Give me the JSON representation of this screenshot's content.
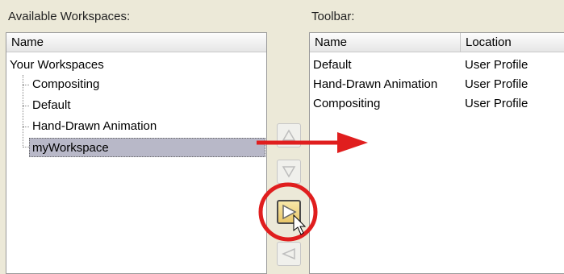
{
  "left_panel": {
    "label": "Available Workspaces:",
    "column_header": "Name",
    "tree": {
      "root": "Your Workspaces",
      "children": [
        "Compositing",
        "Default",
        "Hand-Drawn Animation",
        "myWorkspace"
      ],
      "selected": "myWorkspace"
    }
  },
  "right_panel": {
    "label": "Toolbar:",
    "columns": [
      "Name",
      "Location"
    ],
    "rows": [
      {
        "name": "Default",
        "location": "User Profile"
      },
      {
        "name": "Hand-Drawn Animation",
        "location": "User Profile"
      },
      {
        "name": "Compositing",
        "location": "User Profile"
      }
    ]
  },
  "buttons": {
    "move_up_icon": "triangle-up-icon",
    "move_down_icon": "triangle-down-icon",
    "add_icon": "triangle-right-icon",
    "remove_icon": "triangle-left-icon"
  },
  "annotation_colors": {
    "arrow": "#e01e1e",
    "circle": "#e01e1e"
  }
}
